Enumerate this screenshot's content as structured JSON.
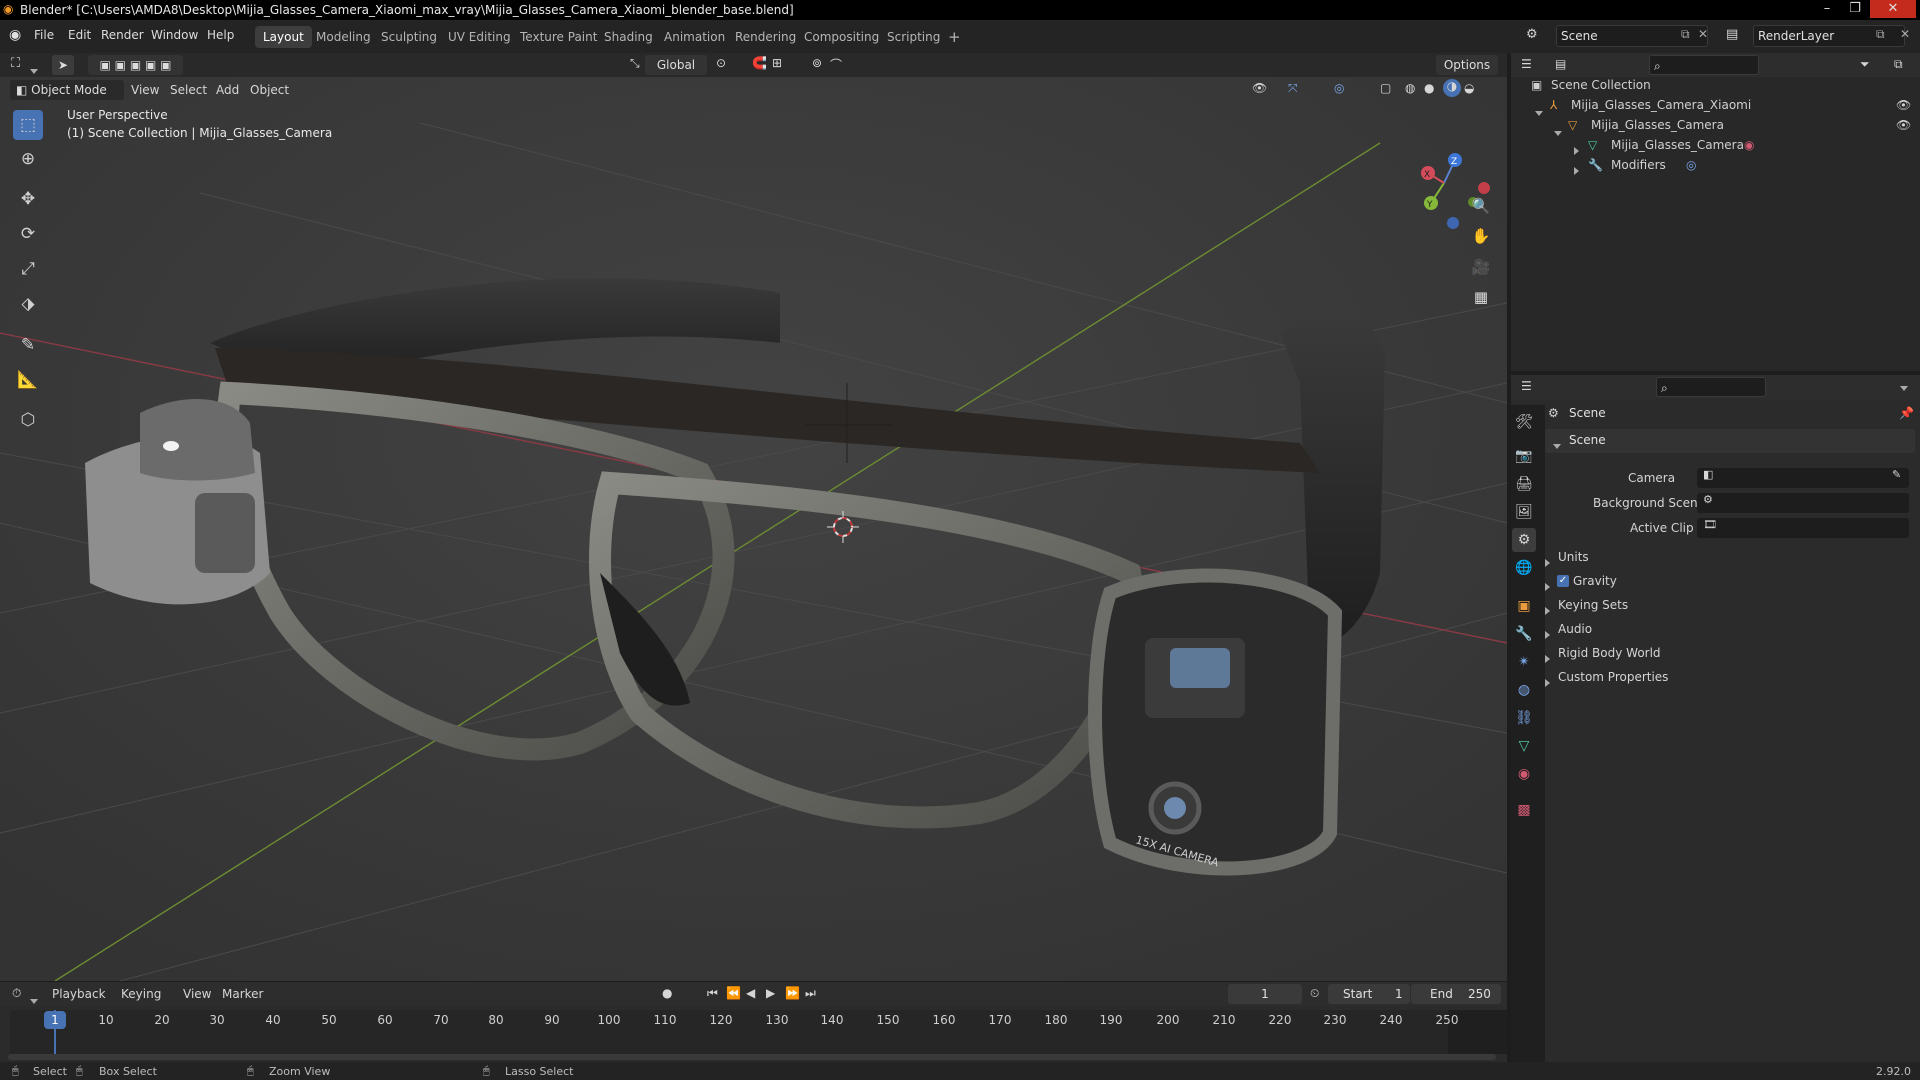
{
  "titlebar": {
    "title": "Blender* [C:\\Users\\AMDA8\\Desktop\\Mijia_Glasses_Camera_Xiaomi_max_vray\\Mijia_Glasses_Camera_Xiaomi_blender_base.blend]"
  },
  "menubar": {
    "menus": [
      "File",
      "Edit",
      "Render",
      "Window",
      "Help"
    ],
    "workspaces": [
      "Layout",
      "Modeling",
      "Sculpting",
      "UV Editing",
      "Texture Paint",
      "Shading",
      "Animation",
      "Rendering",
      "Compositing",
      "Scripting"
    ],
    "add_tab": "+",
    "scene": "Scene",
    "view_layer": "RenderLayer"
  },
  "viewport_header": {
    "transform_orientation": "Global",
    "options": "Options",
    "mode": "Object Mode",
    "menus": [
      "View",
      "Select",
      "Add",
      "Object"
    ]
  },
  "viewport": {
    "perspective": "User Perspective",
    "collection_info": "(1) Scene Collection | Mijia_Glasses_Camera",
    "camera_print": "15X AI CAMERA",
    "gizmo": {
      "x": "X",
      "y": "Y",
      "z": "Z"
    }
  },
  "outliner": {
    "root": "Scene Collection",
    "items": [
      {
        "label": "Mijia_Glasses_Camera_Xiaomi",
        "level": 1
      },
      {
        "label": "Mijia_Glasses_Camera",
        "level": 2
      },
      {
        "label": "Mijia_Glasses_Camera",
        "level": 3
      },
      {
        "label": "Modifiers",
        "level": 3
      }
    ]
  },
  "properties": {
    "context": "Scene",
    "panel": "Scene",
    "fields": [
      {
        "label": "Camera"
      },
      {
        "label": "Background Scene"
      },
      {
        "label": "Active Clip"
      }
    ],
    "sections": [
      {
        "label": "Units",
        "checkbox": false
      },
      {
        "label": "Gravity",
        "checkbox": true,
        "checked": true
      },
      {
        "label": "Keying Sets",
        "checkbox": false
      },
      {
        "label": "Audio",
        "checkbox": false
      },
      {
        "label": "Rigid Body World",
        "checkbox": false
      },
      {
        "label": "Custom Properties",
        "checkbox": false
      }
    ]
  },
  "timeline": {
    "menus": [
      "Playback",
      "Keying",
      "View",
      "Marker"
    ],
    "current_frame": "1",
    "start_label": "Start",
    "start": "1",
    "end_label": "End",
    "end": "250",
    "ticks": [
      "1",
      "10",
      "20",
      "30",
      "40",
      "50",
      "60",
      "70",
      "80",
      "90",
      "100",
      "110",
      "120",
      "130",
      "140",
      "150",
      "160",
      "170",
      "180",
      "190",
      "200",
      "210",
      "220",
      "230",
      "240",
      "250"
    ]
  },
  "statusbar": {
    "hints": [
      "Select",
      "Box Select",
      "Zoom View",
      "Lasso Select"
    ],
    "version": "2.92.0"
  },
  "colors": {
    "accent": "#4772b3",
    "viewport_bg": "#3d3d3d",
    "axis_x": "#b5434e",
    "axis_y": "#7ea13a"
  }
}
